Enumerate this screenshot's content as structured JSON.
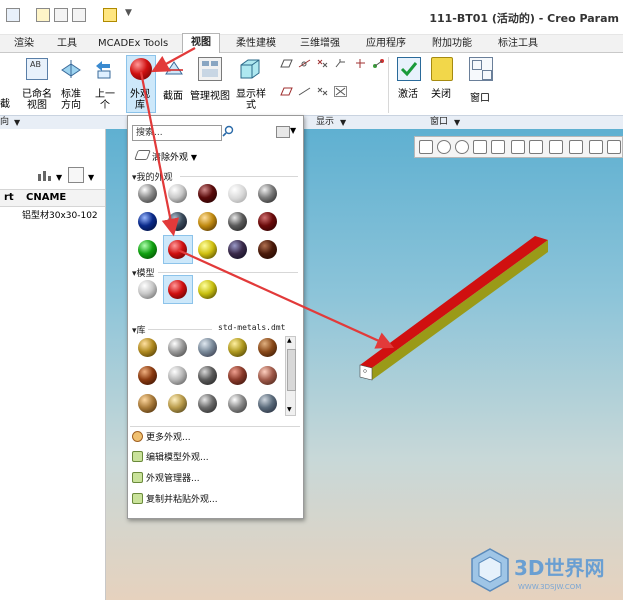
{
  "window": {
    "title": "111-BT01 (活动的) - Creo Param"
  },
  "tabs": [
    "渲染",
    "工具",
    "MCADEx Tools",
    "视图",
    "柔性建模",
    "三维增强",
    "应用程序",
    "附加功能",
    "标注工具"
  ],
  "active_tab": "视图",
  "ribbon": {
    "buttons": {
      "fragment_left": "截",
      "named_view": "已命名\n视图",
      "standard_dir": "标准\n方向",
      "previous": "上一\n个",
      "appearance_lib": "外观\n库",
      "section": "截面",
      "manage_views": "管理视图",
      "display_style": "显示样\n式",
      "activate": "激活",
      "close": "关闭",
      "window": "窗口"
    },
    "groups": {
      "orientation_frag": "向",
      "display": "显示",
      "window": "窗口"
    }
  },
  "left_panel": {
    "col_fragment": "rt",
    "col_cname": "CNAME",
    "row_value": "铝型材30x30-102"
  },
  "dropdown": {
    "search_placeholder": "搜索...",
    "clear_appearance": "清除外观",
    "my_appearances": "我的外观",
    "model": "模型",
    "library": "库",
    "library_file": "std-metals.dmt",
    "menu": [
      "更多外观...",
      "编辑模型外观...",
      "外观管理器...",
      "复制并粘贴外观..."
    ]
  },
  "colors": {
    "red": "#d01010",
    "olive": "#9a9a18",
    "arrow": "#e23a3a",
    "tab_text": "#222222"
  },
  "watermark": {
    "brand": "3D世界网",
    "url": "WWW.3DSJW.COM"
  }
}
